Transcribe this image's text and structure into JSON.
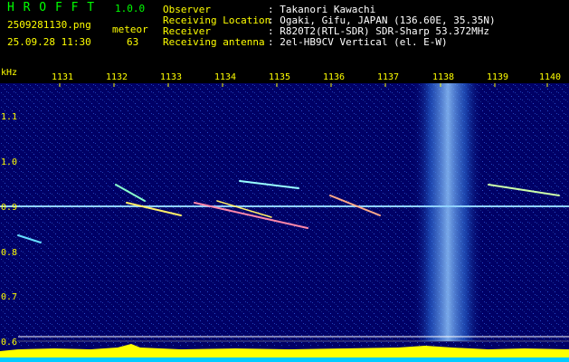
{
  "header": {
    "app_name": "H R O F F T",
    "version": "1.0.0",
    "filename": "2509281130.png",
    "datetime": "25.09.28 11:30",
    "meteor_label": "meteor",
    "meteor_count": "63",
    "info": [
      {
        "label": "Observer",
        "value": ": Takanori Kawachi"
      },
      {
        "label": "Receiving Location",
        "value": ": Ogaki, Gifu, JAPAN (136.60E, 35.35N)"
      },
      {
        "label": "Receiver",
        "value": ": R820T2(RTL-SDR) SDR-Sharp 53.372MHz"
      },
      {
        "label": "Receiving antenna",
        "value": ": 2el-HB9CV Vertical (el. E-W)"
      }
    ]
  },
  "axis": {
    "y_unit": "kHz",
    "x_ticks": [
      "1131",
      "1132",
      "1133",
      "1134",
      "1135",
      "1136",
      "1137",
      "1138",
      "1139",
      "1140"
    ],
    "y_ticks": [
      "1.1",
      "1.0",
      "0.9",
      "0.8",
      "0.7",
      "0.6"
    ]
  },
  "colors": {
    "header_green": "#00ff00",
    "header_yellow": "#ffff00",
    "background": "#000066",
    "level_bar": "#ffff00",
    "level_base": "#00ccff"
  }
}
